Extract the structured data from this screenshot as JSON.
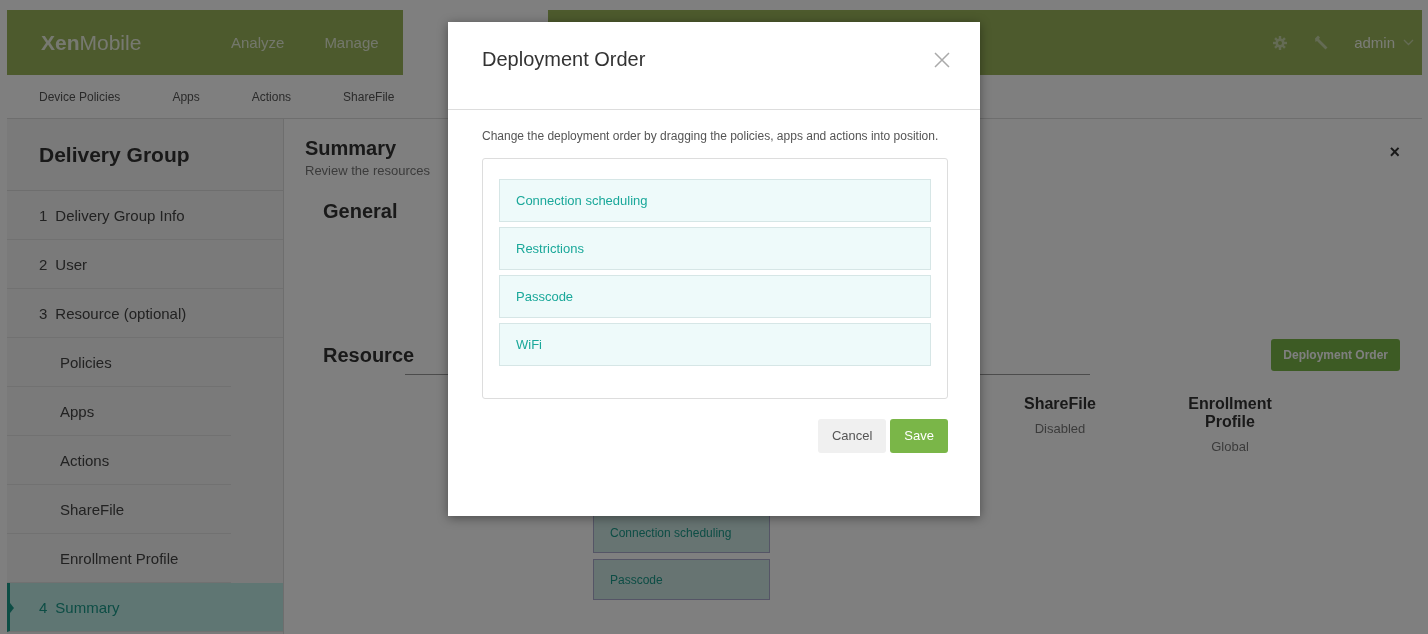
{
  "top_bar": {
    "logo": {
      "bold": "Xen",
      "light": "Mobile"
    },
    "nav": [
      {
        "label": "Analyze",
        "selected": false
      },
      {
        "label": "Manage",
        "selected": false
      }
    ],
    "user": "admin"
  },
  "sub_nav": [
    "Device Policies",
    "Apps",
    "Actions",
    "ShareFile"
  ],
  "sidebar": {
    "title": "Delivery Group",
    "steps": [
      {
        "number": "1",
        "label": "Delivery Group Info",
        "selected": false
      },
      {
        "number": "2",
        "label": "User",
        "selected": false
      },
      {
        "number": "3",
        "label": "Resource (optional)",
        "selected": false,
        "children": [
          {
            "label": "Policies",
            "selected": false
          },
          {
            "label": "Apps",
            "selected": false
          },
          {
            "label": "Actions",
            "selected": false
          },
          {
            "label": "ShareFile",
            "selected": false
          },
          {
            "label": "Enrollment Profile",
            "selected": false
          }
        ]
      },
      {
        "number": "4",
        "label": "Summary",
        "selected": true
      }
    ]
  },
  "main": {
    "title": "Summary",
    "subtitle": "Review the resources",
    "close": "×",
    "general_heading": "General",
    "resource_heading": "Resource",
    "deployment_order_button": "Deployment Order",
    "resource_columns": [
      {
        "title": "ShareFile",
        "value": "Disabled"
      },
      {
        "title": "Enrollment Profile",
        "value": "Global"
      }
    ],
    "resource_list": [
      "Connection scheduling",
      "Passcode"
    ]
  },
  "modal": {
    "title": "Deployment Order",
    "description": "Change the deployment order by dragging the policies, apps and actions into position.",
    "items": [
      "Connection scheduling",
      "Restrictions",
      "Passcode",
      "WiFi"
    ],
    "buttons": [
      {
        "label": "Cancel",
        "kind": "secondary"
      },
      {
        "label": "Save",
        "kind": "primary"
      }
    ]
  }
}
